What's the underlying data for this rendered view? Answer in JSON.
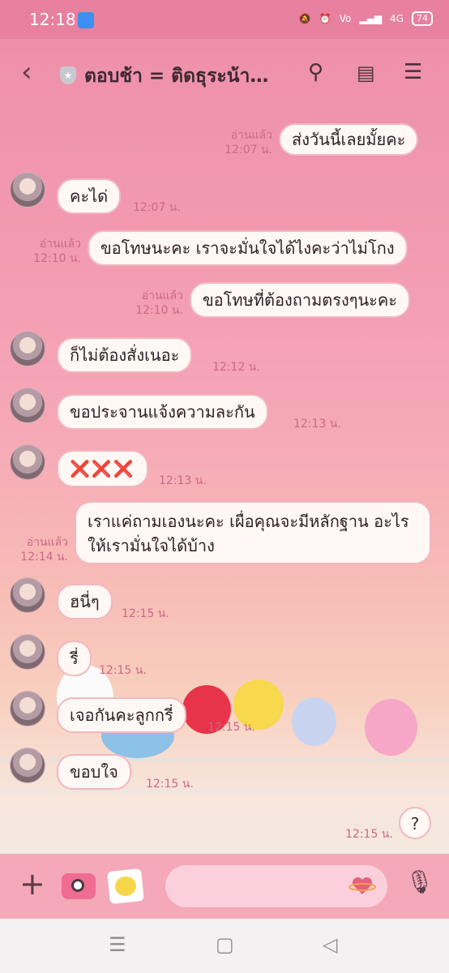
{
  "status_bar": {
    "time": "12:18",
    "network": "4G",
    "battery": "74"
  },
  "header": {
    "title": "ตอบช้า = ติดธุระน้า…"
  },
  "messages": [
    {
      "side": "out",
      "text": "ส่งวันนี้เลยมั้ยคะ",
      "read": "อ่านแล้ว",
      "time": "12:07 น."
    },
    {
      "side": "in",
      "text": "คะได่",
      "time": "12:07 น."
    },
    {
      "side": "out",
      "text": "ขอโทษนะคะ เราจะมั่นใจได้ไงคะว่าไม่โกง",
      "read": "อ่านแล้ว",
      "time": "12:10 น."
    },
    {
      "side": "out",
      "text": "ขอโทษที่ต้องถามตรงๆนะคะ",
      "read": "อ่านแล้ว",
      "time": "12:10 น."
    },
    {
      "side": "in",
      "text": "ก็ไม่ต้องสั่งเนอะ",
      "time": "12:12 น."
    },
    {
      "side": "in",
      "text": "ขอประจานแจ้งความละกัน",
      "time": "12:13 น."
    },
    {
      "side": "in",
      "text": "❌❌❌",
      "time": "12:13 น."
    },
    {
      "side": "out",
      "text": "เราแค่ถามเองนะคะ เผื่อคุณจะมีหลักฐาน อะไรให้เรามั่นใจได้บ้าง",
      "read": "อ่านแล้ว",
      "time": "12:14 น."
    },
    {
      "side": "in",
      "text": "ฮนี่ๆ",
      "time": "12:15 น."
    },
    {
      "side": "in",
      "text": "รี่",
      "time": "12:15 น."
    },
    {
      "side": "in",
      "text": "เจอกันคะลูกกรี่",
      "time": "12:15 น."
    },
    {
      "side": "in",
      "text": "ขอบใจ",
      "time": "12:15 น."
    },
    {
      "side": "out",
      "text": "?",
      "time": "12:15 น."
    }
  ],
  "icons": {
    "back": "chevron-left-icon",
    "search": "search-icon",
    "notes": "notes-icon",
    "menu": "menu-icon",
    "plus": "plus-icon",
    "camera": "camera-icon",
    "sticker": "sticker-icon",
    "mic": "mic-icon"
  },
  "colors": {
    "status_bar": "#e8809f",
    "bubble_border": "#f2b7c0",
    "timestamp": "#c96a85",
    "input_bar": "#f4a8b8"
  }
}
